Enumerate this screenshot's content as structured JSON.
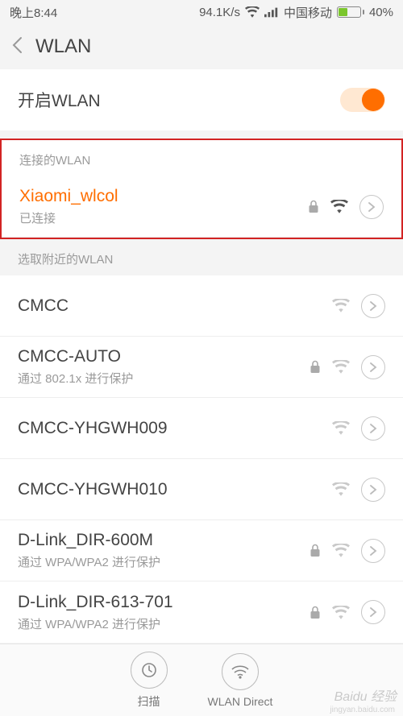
{
  "status": {
    "time": "晚上8:44",
    "speed": "94.1K/s",
    "carrier": "中国移动",
    "battery_pct": "40%"
  },
  "header": {
    "title": "WLAN"
  },
  "wlan_toggle": {
    "label": "开启WLAN",
    "on": true
  },
  "connected_section": {
    "header": "连接的WLAN",
    "network": {
      "name": "Xiaomi_wlcol",
      "status": "已连接",
      "locked": true,
      "signal": "strong"
    }
  },
  "nearby_section": {
    "header": "选取附近的WLAN",
    "networks": [
      {
        "name": "CMCC",
        "sub": "",
        "locked": false,
        "signal": "weak"
      },
      {
        "name": "CMCC-AUTO",
        "sub": "通过 802.1x 进行保护",
        "locked": true,
        "signal": "weak"
      },
      {
        "name": "CMCC-YHGWH009",
        "sub": "",
        "locked": false,
        "signal": "weak"
      },
      {
        "name": "CMCC-YHGWH010",
        "sub": "",
        "locked": false,
        "signal": "weak"
      },
      {
        "name": "D-Link_DIR-600M",
        "sub": "通过 WPA/WPA2 进行保护",
        "locked": true,
        "signal": "weak"
      },
      {
        "name": "D-Link_DIR-613-701",
        "sub": "通过 WPA/WPA2 进行保护",
        "locked": true,
        "signal": "weak"
      }
    ]
  },
  "bottom": {
    "scan": "扫描",
    "direct": "WLAN Direct"
  },
  "watermark": {
    "main": "Baidu 经验",
    "sub": "jingyan.baidu.com"
  }
}
